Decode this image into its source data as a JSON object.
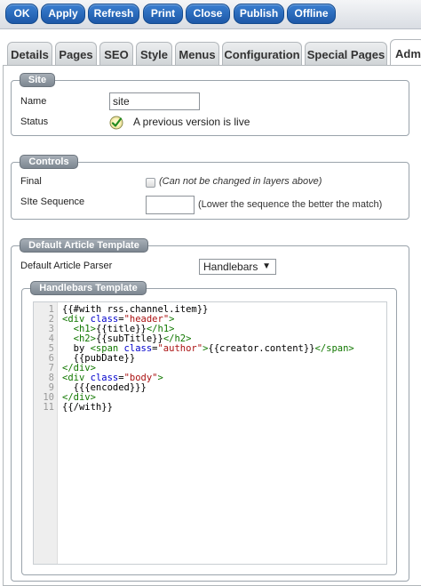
{
  "toolbar": {
    "buttons": [
      "OK",
      "Apply",
      "Refresh",
      "Print",
      "Close",
      "Publish",
      "Offline"
    ]
  },
  "tabs": [
    "Details",
    "Pages",
    "SEO",
    "Style",
    "Menus",
    "Configuration",
    "Special Pages",
    "Admi"
  ],
  "active_tab": "Admi",
  "site_section": {
    "legend": "Site",
    "name_label": "Name",
    "name_value": "site",
    "status_label": "Status",
    "status_icon": "check-circle-icon",
    "status_text": "A previous version is live"
  },
  "controls_section": {
    "legend": "Controls",
    "final_label": "Final",
    "final_hint": "(Can not be changed in layers above)",
    "sequence_label": "SIte Sequence",
    "sequence_value": "",
    "sequence_hint": "(Lower the sequence the better the match)"
  },
  "template_section": {
    "legend": "Default Article Template",
    "parser_label": "Default Article Parser",
    "parser_value": "Handlebars",
    "handlebars_legend": "Handlebars Template",
    "line_numbers": [
      "1",
      "2",
      "3",
      "4",
      "5",
      "6",
      "7",
      "8",
      "9",
      "10",
      "11"
    ]
  },
  "colors": {
    "button": "#1d58a8",
    "legend": "#7d8791",
    "tag": "#117700",
    "attr": "#0000cc",
    "string": "#aa1111"
  }
}
